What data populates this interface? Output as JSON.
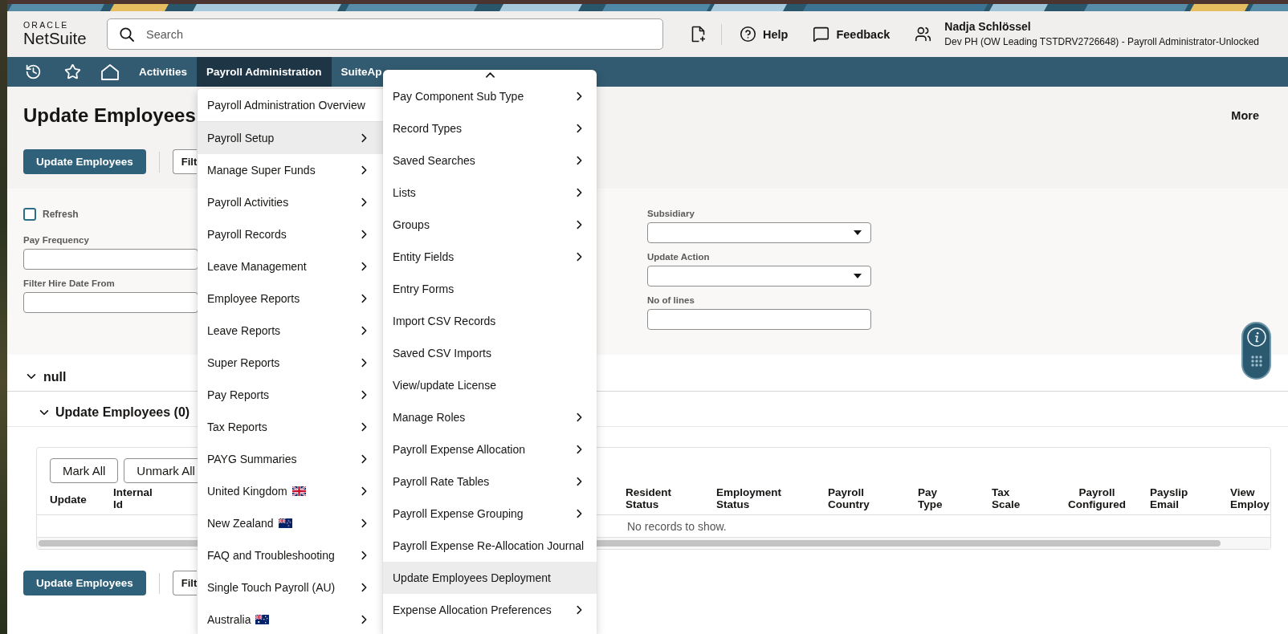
{
  "header": {
    "logo": {
      "brand": "ORACLE",
      "product": "NetSuite"
    },
    "search": {
      "placeholder": "Search"
    },
    "help": "Help",
    "feedback": "Feedback",
    "user": {
      "name": "Nadja Schlössel",
      "role": "Dev PH (OW Leading TSTDRV2726648) - Payroll Administrator-Unlocked"
    }
  },
  "nav": {
    "items": [
      {
        "label": "Activities",
        "selected": false
      },
      {
        "label": "Payroll Administration",
        "selected": true
      },
      {
        "label": "SuiteAp",
        "selected": false
      }
    ]
  },
  "page": {
    "title": "Update Employees",
    "more": "More",
    "buttons": [
      {
        "kind": "primary",
        "label": "Update Employees"
      },
      {
        "kind": "secondary",
        "label": "Filt"
      }
    ]
  },
  "form": {
    "refresh": {
      "label": "Refresh",
      "checked": false
    },
    "left_fields": [
      {
        "label": "Pay Frequency",
        "kind": "text"
      },
      {
        "label": "Filter Hire Date From",
        "kind": "text"
      }
    ],
    "right_fields": [
      {
        "label": "Subsidiary",
        "kind": "select"
      },
      {
        "label": "Update Action",
        "kind": "select"
      },
      {
        "label": "No of lines",
        "kind": "text"
      }
    ]
  },
  "sections": [
    {
      "title": "null",
      "expanded": true,
      "children": [
        {
          "title": "Update Employees (0)",
          "expanded": true
        }
      ]
    }
  ],
  "sublist": {
    "buttons": [
      "Mark All",
      "Unmark All"
    ],
    "columns": [
      {
        "label": "Update",
        "centered": false
      },
      {
        "label": "Internal Id",
        "centered": false
      },
      {
        "label": "Resident Status",
        "centered": false
      },
      {
        "label": "Employment Status",
        "centered": false
      },
      {
        "label": "Payroll Country",
        "centered": false
      },
      {
        "label": "Pay Type",
        "centered": false
      },
      {
        "label": "Tax Scale",
        "centered": false
      },
      {
        "label": "Payroll Configured",
        "centered": true
      },
      {
        "label": "Payslip Email",
        "centered": false
      },
      {
        "label": "View Employ",
        "centered": false
      }
    ],
    "empty_message": "No records to show."
  },
  "bottom_buttons": [
    {
      "kind": "primary",
      "label": "Update Employees"
    },
    {
      "kind": "secondary",
      "label": "Filt"
    }
  ],
  "nav_menu": {
    "groups": [
      {
        "items": [
          {
            "kind": "plain",
            "label": "Payroll Administration Overview",
            "has_submenu": false,
            "selected": false
          }
        ]
      },
      {
        "items": [
          {
            "kind": "plain",
            "label": "Payroll Setup",
            "has_submenu": true,
            "selected": true
          },
          {
            "kind": "plain",
            "label": "Manage Super Funds",
            "has_submenu": true,
            "selected": false
          },
          {
            "kind": "plain",
            "label": "Payroll Activities",
            "has_submenu": true,
            "selected": false
          },
          {
            "kind": "plain",
            "label": "Payroll Records",
            "has_submenu": true,
            "selected": false
          },
          {
            "kind": "plain",
            "label": "Leave Management",
            "has_submenu": true,
            "selected": false
          },
          {
            "kind": "plain",
            "label": "Employee Reports",
            "has_submenu": true,
            "selected": false
          },
          {
            "kind": "plain",
            "label": "Leave Reports",
            "has_submenu": true,
            "selected": false
          },
          {
            "kind": "plain",
            "label": "Super Reports",
            "has_submenu": true,
            "selected": false
          },
          {
            "kind": "plain",
            "label": "Pay Reports",
            "has_submenu": true,
            "selected": false
          },
          {
            "kind": "plain",
            "label": "Tax Reports",
            "has_submenu": true,
            "selected": false
          },
          {
            "kind": "plain",
            "label": "PAYG Summaries",
            "has_submenu": true,
            "selected": false
          },
          {
            "kind": "ukflag",
            "label": "United Kingdom",
            "has_submenu": true,
            "selected": false
          },
          {
            "kind": "nzflag",
            "label": "New Zealand",
            "has_submenu": true,
            "selected": false
          },
          {
            "kind": "plain",
            "label": "FAQ and Troubleshooting",
            "has_submenu": true,
            "selected": false
          },
          {
            "kind": "plain",
            "label": "Single Touch Payroll (AU)",
            "has_submenu": true,
            "selected": false
          },
          {
            "kind": "auflag",
            "label": "Australia",
            "has_submenu": true,
            "selected": false
          }
        ]
      }
    ]
  },
  "setup_submenu": {
    "items": [
      {
        "label": "Pay Component Sub Type",
        "has_submenu": true,
        "selected": false
      },
      {
        "label": "Record Types",
        "has_submenu": true,
        "selected": false
      },
      {
        "label": "Saved Searches",
        "has_submenu": true,
        "selected": false
      },
      {
        "label": "Lists",
        "has_submenu": true,
        "selected": false
      },
      {
        "label": "Groups",
        "has_submenu": true,
        "selected": false
      },
      {
        "label": "Entity Fields",
        "has_submenu": true,
        "selected": false
      },
      {
        "label": "Entry Forms",
        "has_submenu": false,
        "selected": false
      },
      {
        "label": "Import CSV Records",
        "has_submenu": false,
        "selected": false
      },
      {
        "label": "Saved CSV Imports",
        "has_submenu": false,
        "selected": false
      },
      {
        "label": "View/update License",
        "has_submenu": false,
        "selected": false
      },
      {
        "label": "Manage Roles",
        "has_submenu": true,
        "selected": false
      },
      {
        "label": "Payroll Expense Allocation",
        "has_submenu": true,
        "selected": false
      },
      {
        "label": "Payroll Rate Tables",
        "has_submenu": true,
        "selected": false
      },
      {
        "label": "Payroll Expense Grouping",
        "has_submenu": true,
        "selected": false
      },
      {
        "label": "Payroll Expense Re-Allocation Journal",
        "has_submenu": false,
        "selected": false
      },
      {
        "label": "Update Employees Deployment",
        "has_submenu": false,
        "selected": true
      },
      {
        "label": "Expense Allocation Preferences",
        "has_submenu": true,
        "selected": false
      }
    ]
  }
}
